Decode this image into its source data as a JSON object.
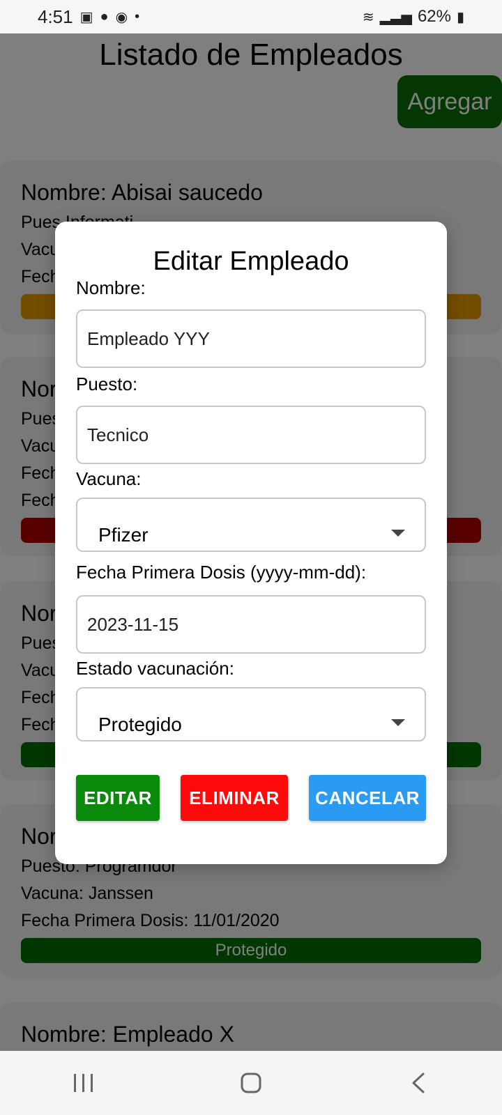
{
  "status_bar": {
    "time": "4:51",
    "battery": "62%"
  },
  "header": {
    "title": "Listado de Empleados",
    "add_label": "Agregar"
  },
  "cards": [
    {
      "name": "Nombre: Abisai saucedo",
      "lines": [
        "Pues  Informati",
        "Vacu",
        "Fech"
      ],
      "status_color": "#e69a00"
    },
    {
      "name": "Nor",
      "lines": [
        "Pues",
        "Vacu",
        "Fech",
        "Fech"
      ],
      "status_color": "#b00000"
    },
    {
      "name": "Nor",
      "lines": [
        "Pues",
        "Vacu",
        "Fech",
        "Fech"
      ],
      "status_color": "#006e00"
    },
    {
      "name": "Nor",
      "lines": [
        "Puesto: Programdor",
        "Vacuna: Janssen",
        "Fecha Primera Dosis: 11/01/2020"
      ],
      "status_text": "Protegido",
      "status_color": "#006e00"
    },
    {
      "name": "Nombre: Empleado X"
    }
  ],
  "modal": {
    "title": "Editar Empleado",
    "labels": {
      "nombre": "Nombre:",
      "puesto": "Puesto:",
      "vacuna": "Vacuna:",
      "fecha": "Fecha Primera Dosis (yyyy-mm-dd):",
      "estado": "Estado vacunación:"
    },
    "values": {
      "nombre": "Empleado YYY",
      "puesto": "Tecnico",
      "vacuna": "Pfizer",
      "fecha": "2023-11-15",
      "estado": "Protegido"
    },
    "buttons": {
      "edit": "EDITAR",
      "delete": "ELIMINAR",
      "cancel": "CANCELAR"
    }
  }
}
